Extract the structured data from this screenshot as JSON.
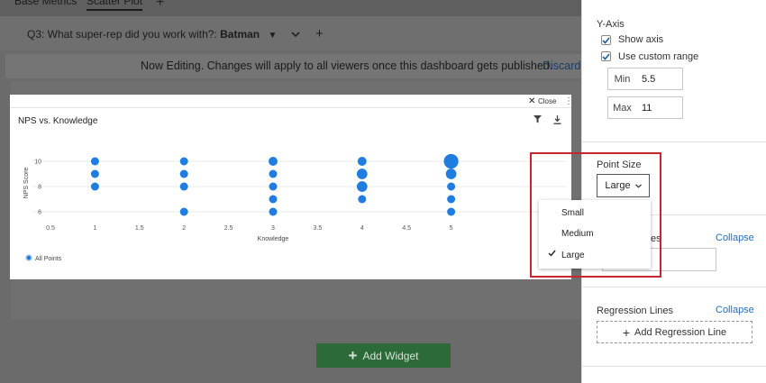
{
  "tabs": [
    {
      "label": "Base Metrics"
    },
    {
      "label": "Scatter Plot"
    }
  ],
  "add_tab_icon": "plus-icon",
  "filter": {
    "question": "Q3: What super-rep did you work with?:",
    "value": "Batman"
  },
  "banner": {
    "text": "Now Editing. Changes will apply to all viewers once this dashboard gets published.",
    "discard": "Discard"
  },
  "widget": {
    "close": "Close",
    "title": "NPS vs. Knowledge"
  },
  "chart_data": {
    "type": "scatter",
    "title": "NPS vs. Knowledge",
    "xlabel": "Knowledge",
    "ylabel": "NPS Score",
    "xlim": [
      0.5,
      5.5
    ],
    "ylim": [
      5.5,
      11
    ],
    "x_ticks": [
      0.5,
      1,
      1.5,
      2,
      2.5,
      3,
      3.5,
      4,
      4.5,
      5
    ],
    "y_ticks": [
      6,
      8,
      10
    ],
    "series": [
      {
        "name": "All Points",
        "color": "#1f7de0",
        "points": [
          {
            "x": 1,
            "y": 10,
            "size": 1
          },
          {
            "x": 1,
            "y": 9,
            "size": 1
          },
          {
            "x": 1,
            "y": 8,
            "size": 1
          },
          {
            "x": 2,
            "y": 10,
            "size": 1
          },
          {
            "x": 2,
            "y": 9,
            "size": 1
          },
          {
            "x": 2,
            "y": 8,
            "size": 1
          },
          {
            "x": 2,
            "y": 6,
            "size": 1
          },
          {
            "x": 3,
            "y": 10,
            "size": 1.1
          },
          {
            "x": 3,
            "y": 9,
            "size": 1
          },
          {
            "x": 3,
            "y": 8,
            "size": 1
          },
          {
            "x": 3,
            "y": 7,
            "size": 1
          },
          {
            "x": 3,
            "y": 6,
            "size": 1
          },
          {
            "x": 4,
            "y": 10,
            "size": 1.1
          },
          {
            "x": 4,
            "y": 9,
            "size": 1.3
          },
          {
            "x": 4,
            "y": 8,
            "size": 1.3
          },
          {
            "x": 4,
            "y": 7,
            "size": 1
          },
          {
            "x": 5,
            "y": 10,
            "size": 1.8
          },
          {
            "x": 5,
            "y": 9,
            "size": 1.3
          },
          {
            "x": 5,
            "y": 8,
            "size": 1
          },
          {
            "x": 5,
            "y": 7,
            "size": 1
          },
          {
            "x": 5,
            "y": 6,
            "size": 1
          }
        ]
      }
    ],
    "legend": "bottom-left",
    "grid": true
  },
  "add_widget": "Add Widget",
  "panel": {
    "y_axis": "Y-Axis",
    "show_axis": "Show axis",
    "custom_range": "Use custom range",
    "min_label": "Min",
    "min_value": "5.5",
    "max_label": "Max",
    "max_value": "11",
    "point_size": "Point Size",
    "point_size_value": "Large",
    "section2_partial": "es",
    "collapse": "Collapse",
    "regression": "Regression Lines",
    "add_regression": "Add Regression Line"
  },
  "dropdown": {
    "options": [
      "Small",
      "Medium",
      "Large"
    ],
    "selected": "Large"
  },
  "colors": {
    "accent": "#1f7de0",
    "button": "#2d6a3a",
    "highlight": "#c9252e",
    "link": "#1f6fbf"
  }
}
